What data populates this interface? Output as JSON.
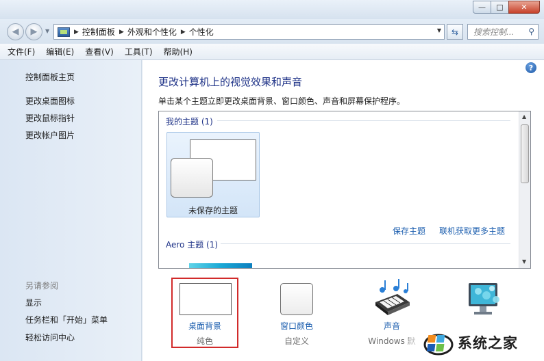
{
  "window": {
    "caption_buttons": {
      "minimize": "—",
      "maximize": "□",
      "close": "✕"
    }
  },
  "navigation": {
    "back_icon": "back-arrow-icon",
    "forward_icon": "forward-arrow-icon",
    "breadcrumbs": [
      "控制面板",
      "外观和个性化",
      "个性化"
    ],
    "search_placeholder": "搜索控制..."
  },
  "menu": [
    "文件(F)",
    "编辑(E)",
    "查看(V)",
    "工具(T)",
    "帮助(H)"
  ],
  "sidebar": {
    "home": "控制面板主页",
    "tasks": [
      "更改桌面图标",
      "更改鼠标指针",
      "更改帐户图片"
    ],
    "see_also_heading": "另请参阅",
    "see_also": [
      "显示",
      "任务栏和「开始」菜单",
      "轻松访问中心"
    ]
  },
  "main": {
    "help_label": "?",
    "heading": "更改计算机上的视觉效果和声音",
    "description": "单击某个主题立即更改桌面背景、窗口颜色、声音和屏幕保护程序。",
    "my_themes_title": "我的主题 (1)",
    "unsaved_theme": "未保存的主题",
    "save_theme": "保存主题",
    "get_more_themes": "联机获取更多主题",
    "aero_title": "Aero 主题 (1)"
  },
  "bottom": {
    "desktop_background": {
      "label": "桌面背景",
      "value": "纯色"
    },
    "window_color": {
      "label": "窗口颜色",
      "value": "自定义"
    },
    "sounds": {
      "label": "声音",
      "value": "Windows 默"
    },
    "screensaver": {
      "label": "",
      "value": ""
    }
  },
  "watermark": {
    "text": "系统之家"
  },
  "colors": {
    "heading": "#1e3287",
    "link": "#1a5dae",
    "highlight_box": "#d12a2a"
  }
}
